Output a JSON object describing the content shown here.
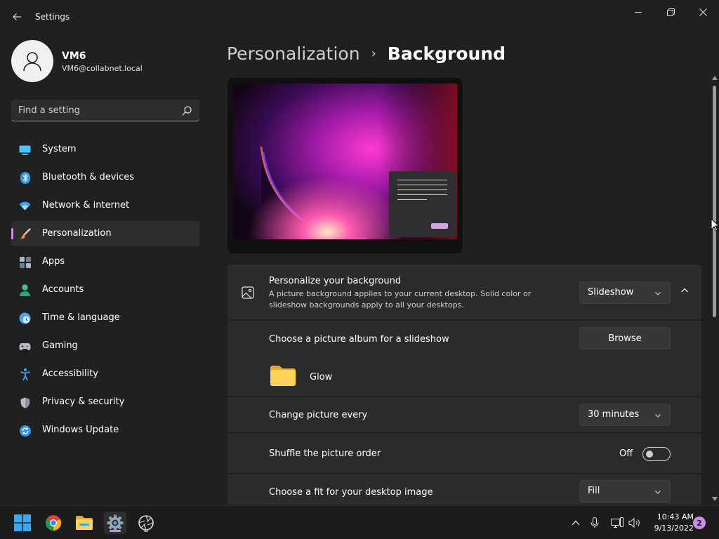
{
  "app": {
    "title": "Settings"
  },
  "user": {
    "name": "VM6",
    "email": "VM6@collabnet.local"
  },
  "search": {
    "placeholder": "Find a setting"
  },
  "nav": {
    "items": [
      {
        "label": "System",
        "icon": "system-monitor-icon"
      },
      {
        "label": "Bluetooth & devices",
        "icon": "bluetooth-icon"
      },
      {
        "label": "Network & internet",
        "icon": "wifi-icon"
      },
      {
        "label": "Personalization",
        "icon": "paintbrush-icon",
        "active": true
      },
      {
        "label": "Apps",
        "icon": "apps-grid-icon"
      },
      {
        "label": "Accounts",
        "icon": "person-icon"
      },
      {
        "label": "Time & language",
        "icon": "clock-globe-icon"
      },
      {
        "label": "Gaming",
        "icon": "gamepad-icon"
      },
      {
        "label": "Accessibility",
        "icon": "accessibility-icon"
      },
      {
        "label": "Privacy & security",
        "icon": "shield-icon"
      },
      {
        "label": "Windows Update",
        "icon": "update-icon"
      }
    ]
  },
  "breadcrumb": {
    "parent": "Personalization",
    "separator": "›",
    "current": "Background"
  },
  "background": {
    "personalize": {
      "title": "Personalize your background",
      "description": "A picture background applies to your current desktop. Solid color or slideshow backgrounds apply to all your desktops.",
      "value": "Slideshow"
    },
    "album": {
      "label": "Choose a picture album for a slideshow",
      "button": "Browse",
      "folder_name": "Glow"
    },
    "interval": {
      "label": "Change picture every",
      "value": "30 minutes"
    },
    "shuffle": {
      "label": "Shuffle the picture order",
      "state": "Off"
    },
    "fit": {
      "label": "Choose a fit for your desktop image",
      "value": "Fill"
    }
  },
  "taskbar": {
    "clock_time": "10:43 AM",
    "clock_date": "9/13/2022",
    "notification_count": "2"
  },
  "colors": {
    "accent": "#c98ee6",
    "background": "#202020",
    "card": "#2b2b2b"
  }
}
